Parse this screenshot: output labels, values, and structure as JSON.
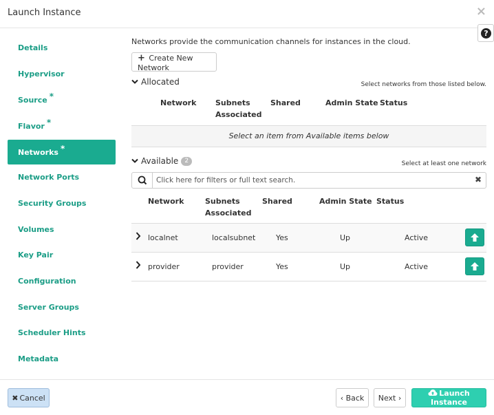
{
  "modal": {
    "title": "Launch Instance",
    "close_icon": "×"
  },
  "help": {
    "icon": "?"
  },
  "sidebar": {
    "items": [
      {
        "label": "Details",
        "required": false
      },
      {
        "label": "Hypervisor",
        "required": false
      },
      {
        "label": "Source",
        "required": true
      },
      {
        "label": "Flavor",
        "required": true
      },
      {
        "label": "Networks",
        "required": true,
        "active": true
      },
      {
        "label": "Network Ports",
        "required": false
      },
      {
        "label": "Security Groups",
        "required": false
      },
      {
        "label": "Volumes",
        "required": false
      },
      {
        "label": "Key Pair",
        "required": false
      },
      {
        "label": "Configuration",
        "required": false
      },
      {
        "label": "Server Groups",
        "required": false
      },
      {
        "label": "Scheduler Hints",
        "required": false
      },
      {
        "label": "Metadata",
        "required": false
      }
    ],
    "required_marker": "*"
  },
  "content": {
    "intro": "Networks provide the communication channels for instances in the cloud.",
    "create_button": "Create New Network",
    "allocated": {
      "title": "Allocated",
      "hint": "Select networks from those listed below.",
      "columns": [
        "Network",
        "Subnets Associated",
        "Shared",
        "Admin State",
        "Status"
      ],
      "empty_text": "Select an item from Available items below"
    },
    "available": {
      "title": "Available",
      "count": "2",
      "hint": "Select at least one network",
      "search_placeholder": "Click here for filters or full text search.",
      "columns": [
        "Network",
        "Subnets Associated",
        "Shared",
        "Admin State",
        "Status"
      ],
      "rows": [
        {
          "network": "localnet",
          "subnets": "localsubnet",
          "shared": "Yes",
          "admin_state": "Up",
          "status": "Active"
        },
        {
          "network": "provider",
          "subnets": "provider",
          "shared": "Yes",
          "admin_state": "Up",
          "status": "Active"
        }
      ]
    }
  },
  "footer": {
    "cancel": "Cancel",
    "back": "Back",
    "next": "Next",
    "launch": "Launch Instance"
  },
  "colors": {
    "accent": "#1aab90",
    "launch": "#2ecfb0",
    "cancel_bg": "#cce1f5"
  }
}
